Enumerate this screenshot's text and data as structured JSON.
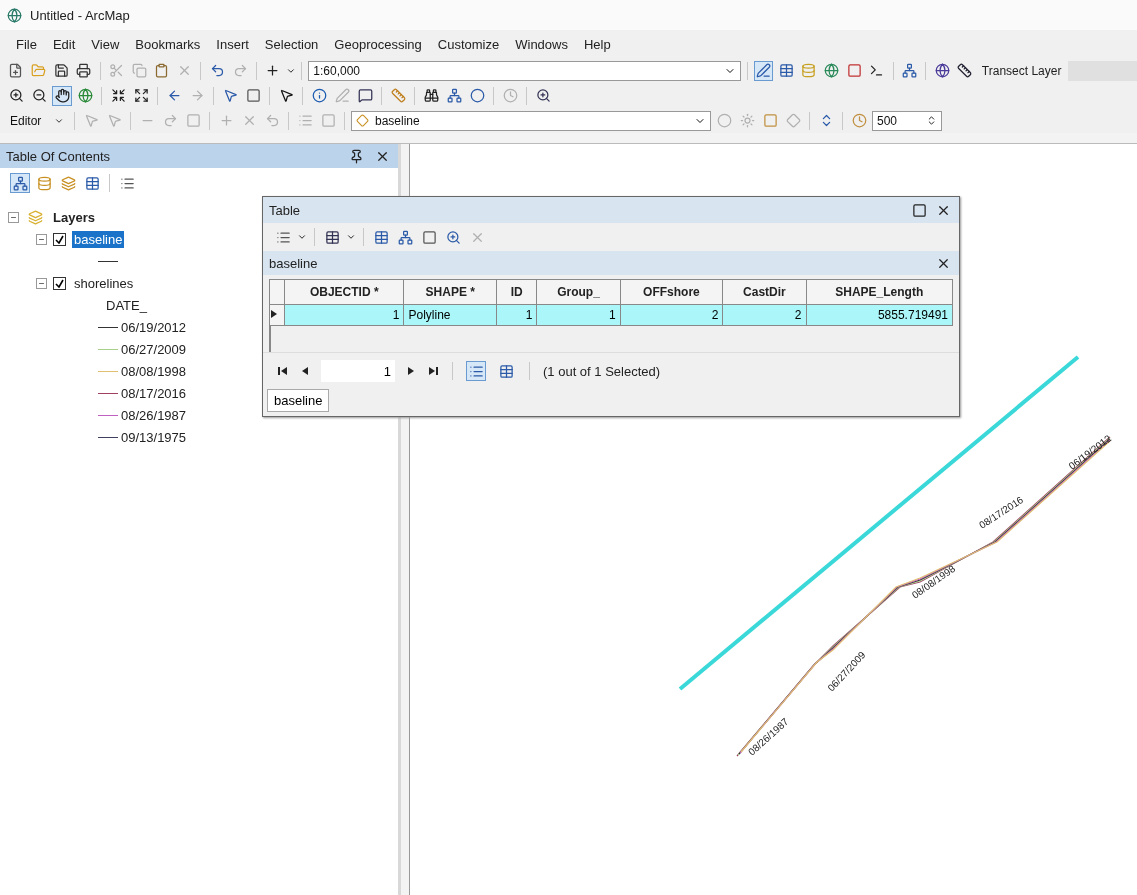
{
  "window": {
    "title": "Untitled - ArcMap"
  },
  "menu": [
    "File",
    "Edit",
    "View",
    "Bookmarks",
    "Insert",
    "Selection",
    "Geoprocessing",
    "Customize",
    "Windows",
    "Help"
  ],
  "standard_toolbar": {
    "scale": "1:60,000",
    "transect_label": "Transect Layer"
  },
  "editor_toolbar": {
    "editor": "Editor",
    "layer": "baseline",
    "value": "500"
  },
  "toc": {
    "title": "Table Of Contents",
    "tree": [
      {
        "label": "Layers",
        "kind": "group",
        "expanded": true,
        "children": [
          {
            "label": "baseline",
            "kind": "layer",
            "checked": true,
            "selected": true,
            "expanded": true,
            "legend": [
              {
                "color": "#333333"
              }
            ]
          },
          {
            "label": "shorelines",
            "kind": "layer",
            "checked": true,
            "selected": false,
            "expanded": true,
            "field": "DATE_",
            "legend": [
              {
                "label": "06/19/2012",
                "color": "#333333"
              },
              {
                "label": "06/27/2009",
                "color": "#a8d08d"
              },
              {
                "label": "08/08/1998",
                "color": "#e0c070"
              },
              {
                "label": "08/17/2016",
                "color": "#a04060"
              },
              {
                "label": "08/26/1987",
                "color": "#c060c0"
              },
              {
                "label": "09/13/1975",
                "color": "#404060"
              }
            ]
          }
        ]
      }
    ]
  },
  "table_window": {
    "title": "Table",
    "layer_title": "baseline",
    "columns": [
      "OBJECTID *",
      "SHAPE *",
      "ID",
      "Group_",
      "OFFshore",
      "CastDir",
      "SHAPE_Length"
    ],
    "rows": [
      {
        "selected": true,
        "cells": [
          "1",
          "Polyline",
          "1",
          "1",
          "2",
          "2",
          "5855.719491"
        ]
      }
    ],
    "record": "1",
    "status": "(1 out of 1 Selected)",
    "tabs": [
      {
        "label": "baseline",
        "selected": true
      }
    ]
  },
  "map": {
    "labels": [
      "08/26/1987",
      "06/27/2009",
      "08/08/1998",
      "08/17/2016",
      "06/19/2012"
    ]
  }
}
